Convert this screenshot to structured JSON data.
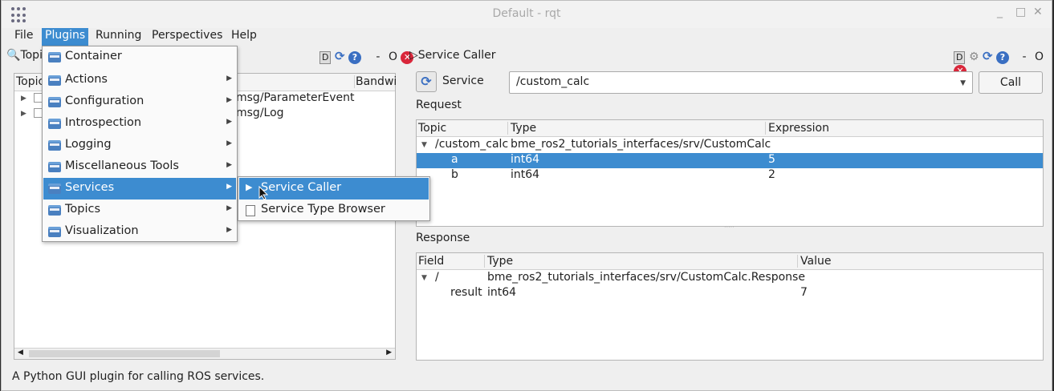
{
  "window": {
    "title": "Default - rqt",
    "controls": {
      "minimize": "_",
      "maximize": "□",
      "close": "✕"
    }
  },
  "menubar": {
    "items": [
      {
        "label": "File"
      },
      {
        "label": "Plugins"
      },
      {
        "label": "Running"
      },
      {
        "label": "Perspectives"
      },
      {
        "label": "Help"
      }
    ]
  },
  "left_dock": {
    "title": "Topi",
    "buttons": {
      "d": "D",
      "dash": "-",
      "o": "O",
      "close": "✕"
    },
    "columns": {
      "topic": "Topic",
      "bandwidth": "Bandwi"
    },
    "rows": [
      {
        "type_suffix": "msg/ParameterEvent"
      },
      {
        "type_suffix": "msg/Log"
      }
    ]
  },
  "right_dock": {
    "title": "Service Caller",
    "buttons": {
      "d": "D",
      "dash": "-",
      "o": "O",
      "close": "✕"
    },
    "service_label": "Service",
    "service_value": "/custom_calc",
    "call_label": "Call",
    "request": {
      "label": "Request",
      "columns": {
        "topic": "Topic",
        "type": "Type",
        "expression": "Expression"
      },
      "rows": [
        {
          "topic": "/custom_calc",
          "type": "bme_ros2_tutorials_interfaces/srv/CustomCalc",
          "expression": ""
        },
        {
          "topic": "a",
          "type": "int64",
          "expression": "5"
        },
        {
          "topic": "b",
          "type": "int64",
          "expression": "2"
        }
      ]
    },
    "response": {
      "label": "Response",
      "columns": {
        "field": "Field",
        "type": "Type",
        "value": "Value"
      },
      "rows": [
        {
          "field": "/",
          "type": "bme_ros2_tutorials_interfaces/srv/CustomCalc.Response",
          "value": ""
        },
        {
          "field": "result",
          "type": "int64",
          "value": "7"
        }
      ]
    }
  },
  "plugins_menu": {
    "items": [
      {
        "label": "Container"
      },
      {
        "label": "Actions"
      },
      {
        "label": "Configuration"
      },
      {
        "label": "Introspection"
      },
      {
        "label": "Logging"
      },
      {
        "label": "Miscellaneous Tools"
      },
      {
        "label": "Services"
      },
      {
        "label": "Topics"
      },
      {
        "label": "Visualization"
      }
    ]
  },
  "services_submenu": {
    "items": [
      {
        "label": "Service Caller"
      },
      {
        "label": "Service Type Browser"
      }
    ]
  },
  "statusbar": {
    "text": "A Python GUI plugin for calling ROS services."
  }
}
